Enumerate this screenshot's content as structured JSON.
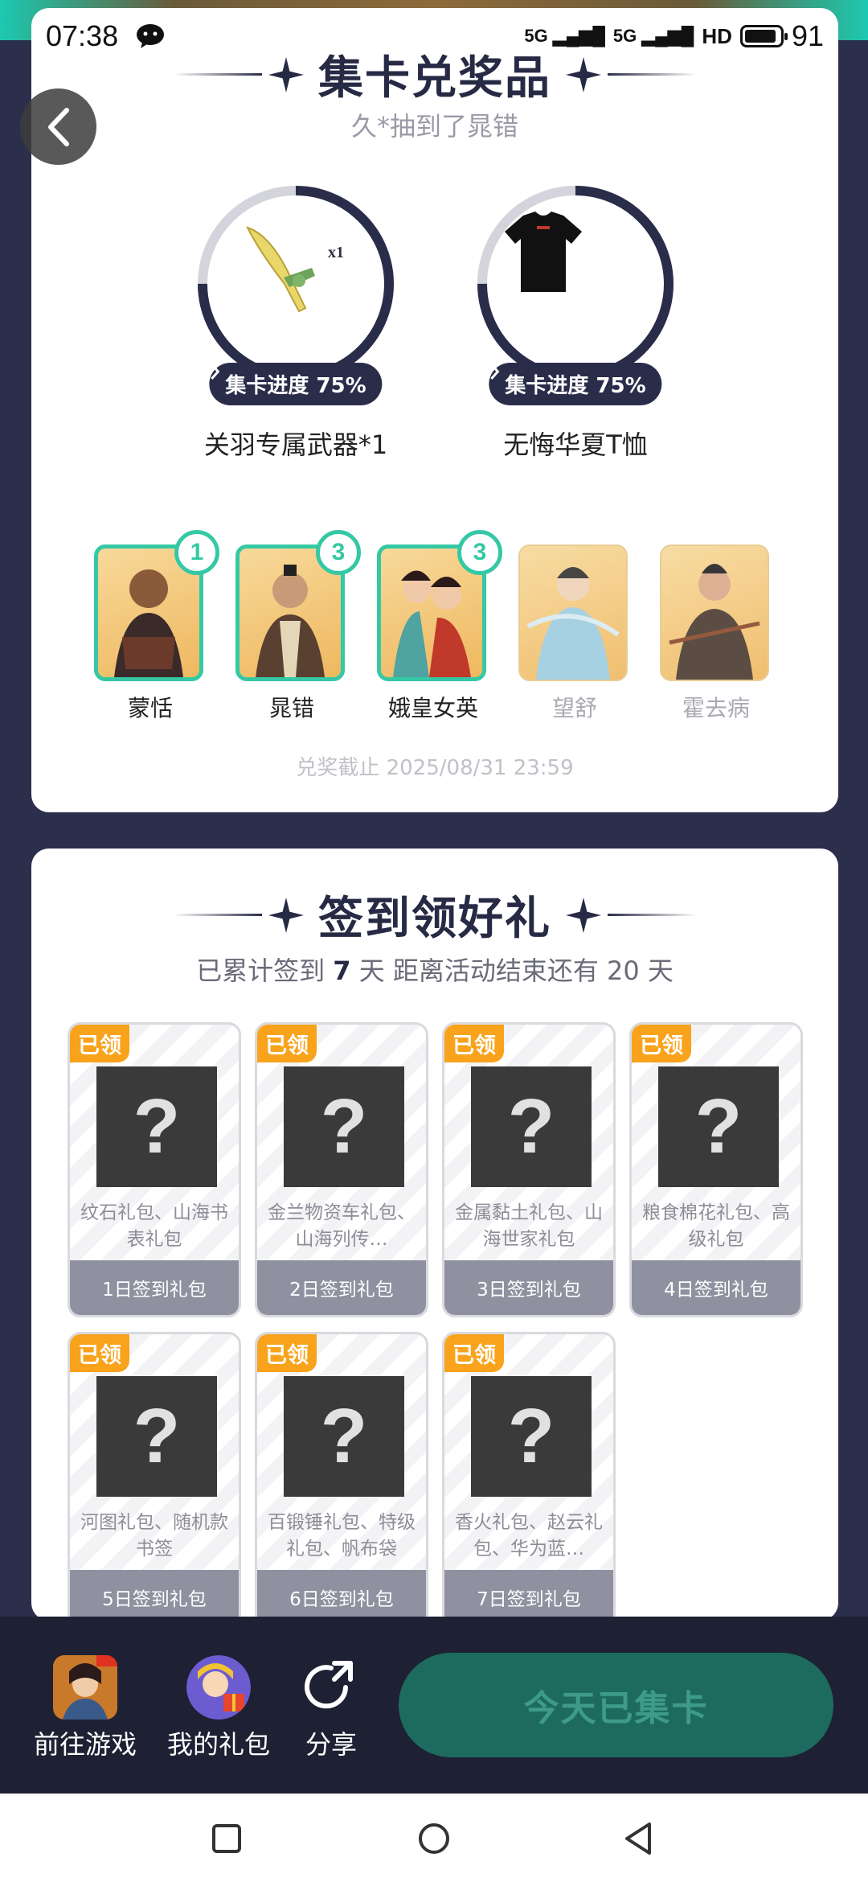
{
  "status_bar": {
    "time": "07:38",
    "signal1": "5G",
    "signal2": "5G",
    "hd": "HD",
    "battery": "91"
  },
  "prize_section": {
    "title": "集卡兑奖品",
    "subtitle": "久*抽到了晁错",
    "prizes": [
      {
        "name": "关羽专属武器*1",
        "progress_label": "集卡进度 75%",
        "progress": 0.75,
        "qty": "x1"
      },
      {
        "name": "无悔华夏T恤",
        "progress_label": "集卡进度 75%",
        "progress": 0.75
      }
    ],
    "heroes": [
      {
        "name": "蒙恬",
        "count": "1",
        "owned": true
      },
      {
        "name": "晁错",
        "count": "3",
        "owned": true
      },
      {
        "name": "娥皇女英",
        "count": "3",
        "owned": true
      },
      {
        "name": "望舒",
        "owned": false
      },
      {
        "name": "霍去病",
        "owned": false
      }
    ],
    "deadline": "兑奖截止 2025/08/31 23:59"
  },
  "signin_section": {
    "title": "签到领好礼",
    "subtitle_prefix": "已累计签到 ",
    "days_signed": "7",
    "subtitle_suffix": " 天  距离活动结束还有 20 天",
    "claimed_label": "已领",
    "gifts": [
      {
        "desc": "纹石礼包、山海书表礼包",
        "day": "1日签到礼包"
      },
      {
        "desc": "金兰物资车礼包、山海列传…",
        "day": "2日签到礼包"
      },
      {
        "desc": "金属黏土礼包、山海世家礼包",
        "day": "3日签到礼包"
      },
      {
        "desc": "粮食棉花礼包、高级礼包",
        "day": "4日签到礼包"
      },
      {
        "desc": "河图礼包、随机款书签",
        "day": "5日签到礼包"
      },
      {
        "desc": "百锻锤礼包、特级礼包、帆布袋",
        "day": "6日签到礼包"
      },
      {
        "desc": "香火礼包、赵云礼包、华为蓝…",
        "day": "7日签到礼包"
      }
    ]
  },
  "action_bar": {
    "go_game": "前往游戏",
    "my_gifts": "我的礼包",
    "share": "分享",
    "collect": "今天已集卡"
  },
  "colors": {
    "accent": "#35c8a5",
    "dark": "#2a2d4a",
    "claimed": "#f8a31b",
    "collect_btn": "#1d6b5f"
  }
}
